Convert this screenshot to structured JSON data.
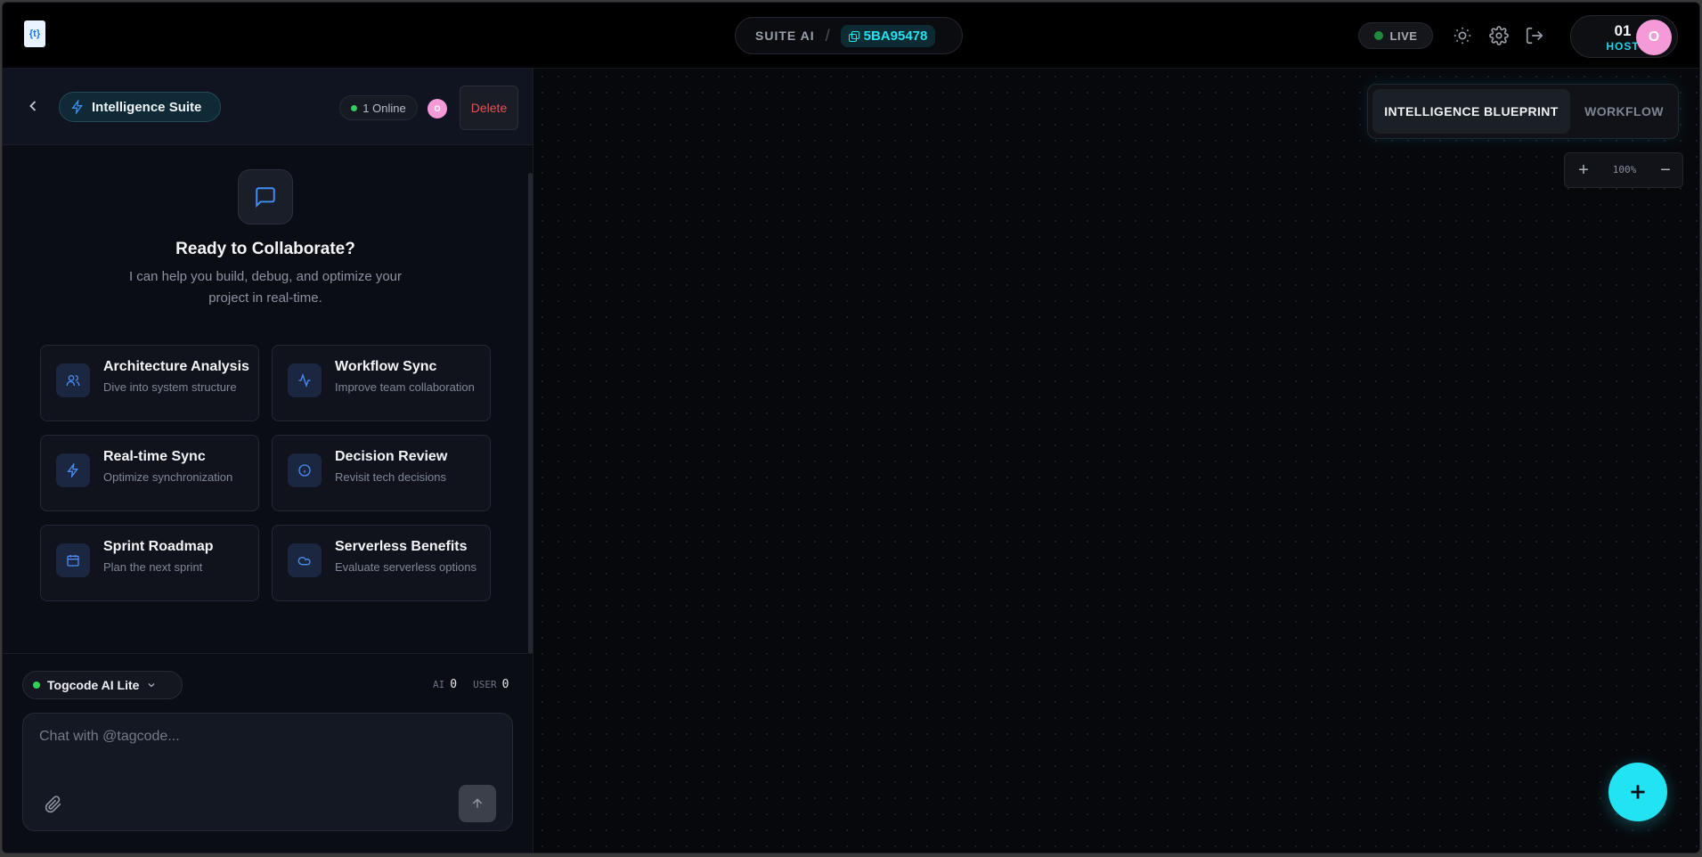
{
  "topbar": {
    "logo_text": "{t}",
    "breadcrumb": {
      "brand": "SUITE AI",
      "separator": "/",
      "session_code": "5BA95478"
    },
    "status": {
      "label": "LIVE",
      "color": "#1f8a3a"
    },
    "icons": [
      "sun-icon",
      "gear-icon",
      "logout-icon"
    ],
    "host": {
      "count": "01",
      "label": "HOST",
      "avatar_initial": "O"
    }
  },
  "panel": {
    "header": {
      "suite_label": "Intelligence Suite",
      "online_label": "1 Online",
      "avatar_initial": "O",
      "delete_label": "Delete"
    },
    "hero": {
      "title": "Ready to Collaborate?",
      "subtitle": "I can help you build, debug, and optimize your project in real-time."
    },
    "cards": [
      {
        "title": "Architecture Analysis",
        "desc": "Dive into system structure",
        "icon": "users-icon"
      },
      {
        "title": "Workflow Sync",
        "desc": "Improve team collaboration",
        "icon": "activity-icon"
      },
      {
        "title": "Real-time Sync",
        "desc": "Optimize synchronization",
        "icon": "bolt-icon"
      },
      {
        "title": "Decision Review",
        "desc": "Revisit tech decisions",
        "icon": "info-icon"
      },
      {
        "title": "Sprint Roadmap",
        "desc": "Plan the next sprint",
        "icon": "calendar-icon"
      },
      {
        "title": "Serverless Benefits",
        "desc": "Evaluate serverless options",
        "icon": "cloud-icon"
      }
    ],
    "composer": {
      "model_label": "Togcode AI Lite",
      "ai_label": "AI",
      "ai_count": "0",
      "user_label": "USER",
      "user_count": "0",
      "placeholder": "Chat with @tagcode..."
    }
  },
  "canvas": {
    "tabs": [
      {
        "label": "INTELLIGENCE BLUEPRINT",
        "active": true
      },
      {
        "label": "WORKFLOW",
        "active": false
      }
    ],
    "zoom": {
      "plus": "+",
      "level": "100%",
      "minus": "−"
    },
    "fab_icon": "plus-icon",
    "accent_color": "#22e3f1"
  }
}
